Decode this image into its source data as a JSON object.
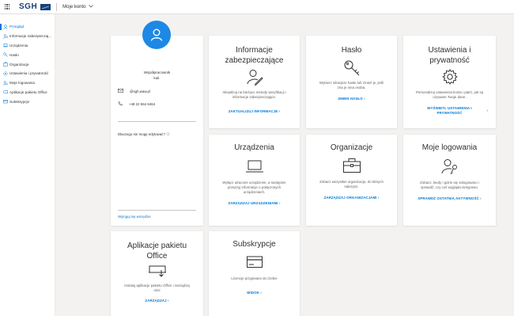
{
  "header": {
    "org_logo_text": "SGH",
    "app_title": "Moje konto"
  },
  "sidebar": {
    "items": [
      {
        "label": "Przegląd",
        "icon": "person-icon",
        "active": true
      },
      {
        "label": "Informacje zabezpieczaj...",
        "icon": "security-info-icon",
        "active": false
      },
      {
        "label": "Urządzenia",
        "icon": "laptop-icon",
        "active": false
      },
      {
        "label": "Hasło",
        "icon": "key-icon",
        "active": false
      },
      {
        "label": "Organizacje",
        "icon": "briefcase-icon",
        "active": false
      },
      {
        "label": "Ustawienia i prywatność",
        "icon": "gear-icon",
        "active": false
      },
      {
        "label": "Moje logowania",
        "icon": "sign-ins-icon",
        "active": false
      },
      {
        "label": "Aplikacje pakietu Office",
        "icon": "office-apps-icon",
        "active": false
      },
      {
        "label": "Subskrypcje",
        "icon": "subscription-icon",
        "active": false
      }
    ]
  },
  "profile": {
    "name_line1": "Współpracownik",
    "name_line2": "kuli.",
    "email": "@sgh.waw.pl",
    "phone": "+48 22 564 6464",
    "why_cant_edit": "Dlaczego nie mogę edytować? ⓘ",
    "sign_out": "Wyloguj się wszędzie"
  },
  "cards": {
    "security_info": {
      "title": "Informacje zabezpieczające",
      "desc": "Aktualizuj na bieżąco metody weryfikacji i informacje zabezpieczające.",
      "link": "ZAKTUALIZUJ INFORMACJE",
      "arrow": "›"
    },
    "password": {
      "title": "Hasło",
      "desc": "Wybierz silniejsze hasło lub zmień je, jeśli zna je inna osoba.",
      "link": "ZMIEŃ HASŁO",
      "arrow": "›"
    },
    "settings": {
      "title": "Ustawienia i prywatność",
      "desc": "Personalizuj ustawienia konta i patrz, jak są używane Twoje dane.",
      "link_line1": "WYŚWIETL USTAWIENIA I",
      "link_line2": "PRYWATNOŚĆ",
      "arrow": "›"
    },
    "devices": {
      "title": "Urządzenia",
      "desc": "Wyłącz utracone urządzenie, a następnie przejrzyj informacje o połączonych urządzeniach.",
      "link": "ZARZĄDZAJ URZĄDZENIAMI",
      "arrow": "›"
    },
    "organizations": {
      "title": "Organizacje",
      "desc": "Zobacz wszystkie organizacje, do których należysz.",
      "link": "ZARZĄDZAJ ORGANIZACJAMI",
      "arrow": "›"
    },
    "signins": {
      "title": "Moje logowania",
      "desc": "Zobacz, kiedy i gdzie się zalogowano i sprawdź, czy coś wygląda nietypowo.",
      "link": "SPRAWDŹ OSTATNIĄ AKTYWNOŚĆ",
      "arrow": "›"
    },
    "office_apps": {
      "title": "Aplikacje pakietu Office",
      "desc": "Instaluj aplikacje pakietu Office i zarządzaj nimi",
      "link": "ZARZĄDZAJ",
      "arrow": "›"
    },
    "subscriptions": {
      "title": "Subskrypcje",
      "desc": "Licencje przypisane do Ciebie",
      "link": "WIDOK",
      "arrow": "›"
    }
  },
  "colors": {
    "accent": "#0078d4",
    "avatar": "#1e88e5",
    "brand": "#1a3f79"
  }
}
